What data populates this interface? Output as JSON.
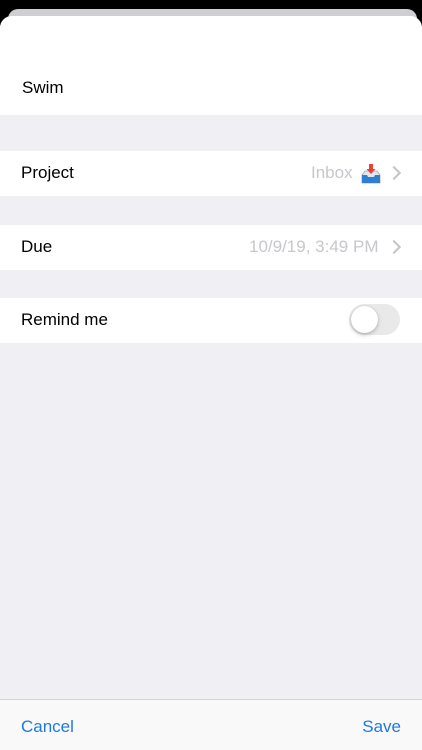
{
  "task": {
    "title": "Swim"
  },
  "rows": {
    "project": {
      "label": "Project",
      "value": "Inbox",
      "icon": "inbox-tray-icon"
    },
    "due": {
      "label": "Due",
      "value": "10/9/19, 3:49 PM"
    },
    "remind": {
      "label": "Remind me",
      "enabled": false
    }
  },
  "toolbar": {
    "cancel_label": "Cancel",
    "save_label": "Save"
  },
  "colors": {
    "accent": "#1f7ae0",
    "group_background": "#efeff4",
    "secondary_text": "#c7c7cc"
  }
}
